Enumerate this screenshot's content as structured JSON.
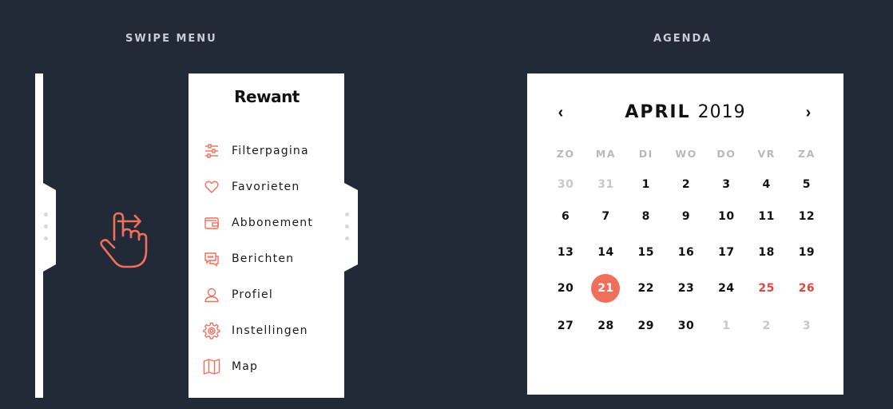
{
  "sections": {
    "swipe_menu_title": "SWIPE MENU",
    "agenda_title": "AGENDA"
  },
  "colors": {
    "background": "#222937",
    "accent": "#ef6f5c",
    "weekend": "#e1463f",
    "muted": "#c8c8c8"
  },
  "menu": {
    "logo": "Rewant",
    "items": [
      {
        "label": "Filterpagina",
        "icon": "filter-sliders-icon"
      },
      {
        "label": "Favorieten",
        "icon": "heart-icon"
      },
      {
        "label": "Abbonement",
        "icon": "wallet-icon"
      },
      {
        "label": "Berichten",
        "icon": "chat-bubbles-icon"
      },
      {
        "label": "Profiel",
        "icon": "user-icon"
      },
      {
        "label": "Instellingen",
        "icon": "gear-icon"
      },
      {
        "label": "Map",
        "icon": "map-icon"
      }
    ]
  },
  "calendar": {
    "month": "APRIL",
    "year": "2019",
    "prev_label": "‹",
    "next_label": "›",
    "weekdays": [
      "ZO",
      "MA",
      "DI",
      "WO",
      "DO",
      "VR",
      "ZA"
    ],
    "weeks": [
      [
        "30",
        "31",
        "1",
        "2",
        "3",
        "4",
        "5"
      ],
      [
        "6",
        "7",
        "8",
        "9",
        "10",
        "11",
        "12"
      ],
      [
        "13",
        "14",
        "15",
        "16",
        "17",
        "18",
        "19"
      ],
      [
        "20",
        "21",
        "22",
        "23",
        "24",
        "25",
        "26"
      ],
      [
        "27",
        "28",
        "29",
        "30",
        "1",
        "2",
        "3"
      ]
    ]
  }
}
